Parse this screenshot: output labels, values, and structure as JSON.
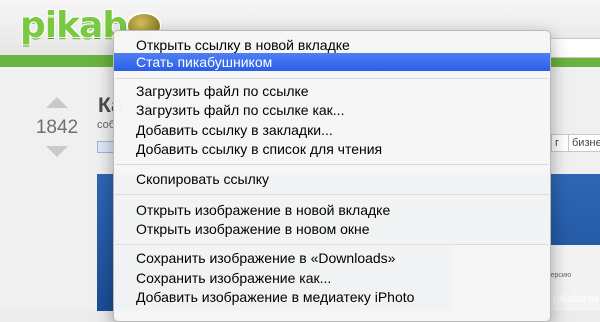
{
  "header": {
    "logo_text": "pikabu"
  },
  "post": {
    "rating": "1842",
    "title_fragment": "Ка",
    "meta_fragment": "соб",
    "tags": [
      "",
      ""
    ]
  },
  "tag_labels": [
    "г",
    "бизне"
  ],
  "post_image": {
    "window_text": "версию"
  },
  "watermark": "pikabu.ru",
  "context_menu": {
    "items": [
      "Открыть ссылку в новой вкладке",
      "Стать пикабушником",
      "Загрузить файл по ссылке",
      "Загрузить файл по ссылке как...",
      "Добавить ссылку в закладки...",
      "Добавить ссылку в список для чтения",
      "Скопировать ссылку",
      "Открыть изображение в новой вкладке",
      "Открыть изображение в новом окне",
      "Сохранить изображение в «Downloads»",
      "Сохранить изображение как...",
      "Добавить изображение в медиатеку iPhoto"
    ]
  }
}
